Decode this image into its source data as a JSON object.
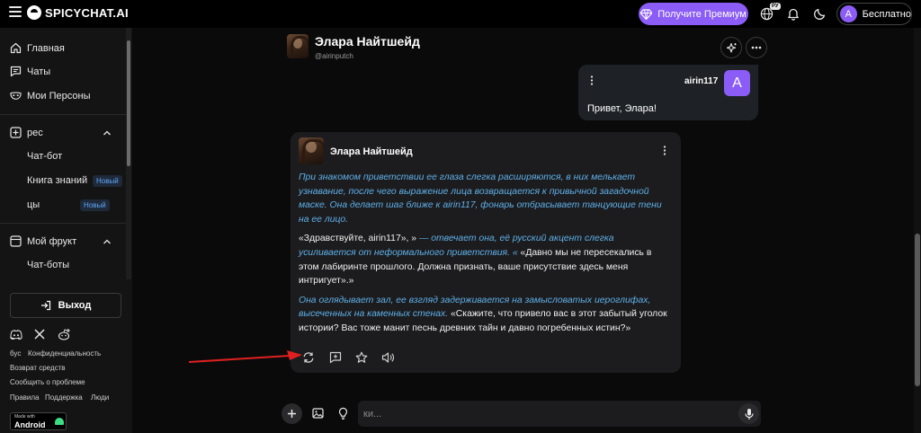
{
  "brand": {
    "name": "SPICYCHAT.AI"
  },
  "topbar": {
    "premium_label": "Получите Премиум",
    "lang_badge": "РУ",
    "user_initial": "A",
    "plan_label": "Бесплатно"
  },
  "sidebar": {
    "nav": [
      {
        "label": "Главная",
        "icon": "home-icon"
      },
      {
        "label": "Чаты",
        "icon": "chat-icon"
      },
      {
        "label": "Мои Персоны",
        "icon": "mask-icon"
      }
    ],
    "section_create": {
      "label": "рес",
      "items": [
        {
          "label": "Чат-бот"
        },
        {
          "label": "Книга знаний",
          "badge": "Новый"
        },
        {
          "label": "цы",
          "badge": "Новый"
        }
      ]
    },
    "section_my": {
      "label": "Мой фрукт",
      "items": [
        {
          "label": "Чат-боты"
        }
      ]
    },
    "exit_label": "Выход",
    "footer_links": [
      "бус",
      "Конфиденциальность",
      "Возврат средств",
      "Сообщить о проблеме",
      "Правила",
      "Поддержка",
      "Люди"
    ],
    "android": {
      "line1": "Made with",
      "line2": "Android"
    }
  },
  "chat": {
    "character_name": "Элара Найтшейд",
    "character_handle": "@airinputch",
    "user_message": {
      "username": "airin117",
      "avatar_initial": "A",
      "text": "Привет, Элара!"
    },
    "bot_message": {
      "name": "Элара Найтшейд",
      "p1_italic": "При знакомом приветствии ее глаза слегка расширяются, в них мелькает узнавание, после чего выражение лица возвращается к привычной загадочной маске. Она делает шаг ближе к airin117, фонарь отбрасывает танцующие тени на ее лицо.",
      "p2_a": "«Здравствуйте, airin117», »",
      "p2_b": " — отвечает она, её русский акцент слегка усиливается от неформального приветствия. «",
      "p2_c": " «Давно мы не пересекались в этом лабиринте прошлого. Должна признать, ваше присутствие здесь меня интригует».»",
      "p3_italic": "Она оглядывает зал, ее взгляд задерживается на замысловатых иероглифах, высеченных на каменных стенах.",
      "p3_normal": " «Скажите, что привело вас в этот забытый уголок истории? Вас тоже манит песнь древних тайн и давно погребенных истин?»"
    },
    "composer_placeholder": "ки..."
  },
  "colors": {
    "accent": "#8b5cf6",
    "italic_text": "#5fb0e8",
    "annotation_arrow": "#e02020"
  }
}
